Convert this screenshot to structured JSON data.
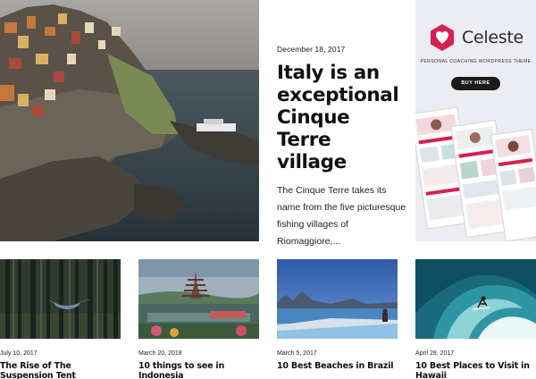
{
  "featured": {
    "date": "December 18, 2017",
    "title": "Italy is an exceptional Cinque Terre village",
    "excerpt": "The Cinque Terre takes its name from the five picturesque fishing villages of Riomaggiore,..."
  },
  "ad": {
    "brand": "Celeste",
    "tagline": "PERSONAL COACHING WORDPRESS THEME",
    "button_label": "BUY HERE",
    "accent_color": "#d6204e"
  },
  "posts": [
    {
      "date": "July 10, 2017",
      "title": "The Rise of The Suspension Tent"
    },
    {
      "date": "March 20, 2018",
      "title": "10 things to see in Indonesia"
    },
    {
      "date": "March 5, 2017",
      "title": "10 Best Beaches in Brazil"
    },
    {
      "date": "April 28, 2017",
      "title": "10 Best Places to Visit in Hawaii"
    }
  ]
}
